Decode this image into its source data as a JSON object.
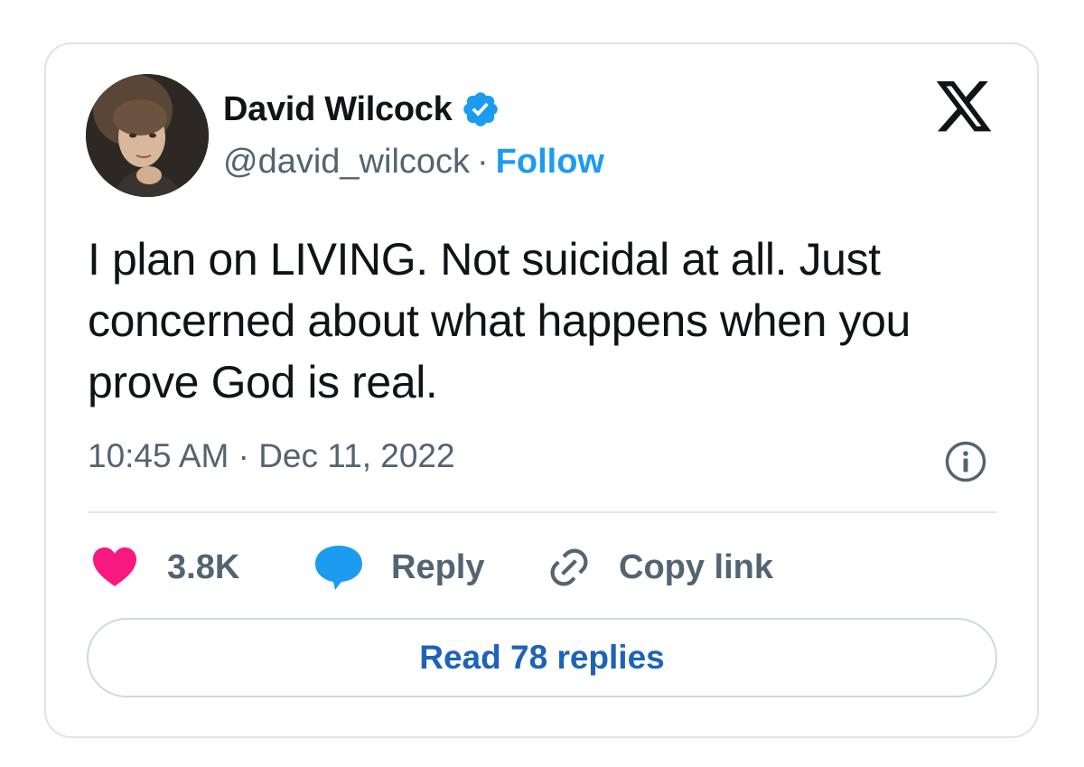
{
  "author": {
    "display_name": "David Wilcock",
    "handle": "@david_wilcock",
    "separator": "·",
    "follow_label": "Follow"
  },
  "tweet": {
    "text": "I plan on LIVING. Not suicidal at all. Just concerned about what happens when you prove God is real.",
    "timestamp": "10:45 AM · Dec 11, 2022"
  },
  "actions": {
    "like_count": "3.8K",
    "reply_label": "Reply",
    "copy_link_label": "Copy link"
  },
  "read_replies_label": "Read 78 replies",
  "icons": {
    "verified": "verified-badge-icon",
    "platform": "x-logo-icon",
    "info": "info-icon",
    "like": "heart-icon",
    "reply": "speech-bubble-icon",
    "copy": "link-icon"
  },
  "colors": {
    "accent": "#1d9bf0",
    "read_replies": "#1d63b8",
    "like": "#f91880",
    "text": "#0f1419",
    "muted": "#536471",
    "border": "#dfe3e8"
  }
}
